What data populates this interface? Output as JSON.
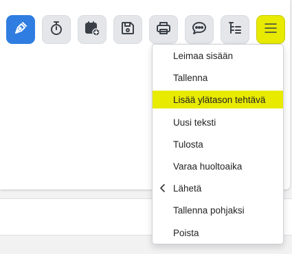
{
  "toolbar": {
    "buttons": [
      {
        "name": "sign-button",
        "icon": "pen-nib-icon"
      },
      {
        "name": "timer-button",
        "icon": "stopwatch-icon"
      },
      {
        "name": "schedule-button",
        "icon": "calendar-add-icon"
      },
      {
        "name": "save-button",
        "icon": "floppy-disk-icon"
      },
      {
        "name": "print-button",
        "icon": "printer-icon"
      },
      {
        "name": "comment-button",
        "icon": "chat-bubble-icon"
      },
      {
        "name": "hierarchy-button",
        "icon": "tree-list-icon"
      },
      {
        "name": "more-menu-button",
        "icon": "hamburger-menu-icon"
      }
    ],
    "colors": {
      "primary": "#2f7de1",
      "active": "#e8ea00",
      "button_bg": "#e4e6ea",
      "icon": "#3a3f47"
    }
  },
  "menu": {
    "items": [
      {
        "label": "Leimaa sisään"
      },
      {
        "label": "Tallenna"
      },
      {
        "label": "Lisää ylätason tehtävä",
        "highlighted": true
      },
      {
        "label": "Uusi teksti"
      },
      {
        "label": "Tulosta"
      },
      {
        "label": "Varaa huoltoaika"
      },
      {
        "label": "Lähetä",
        "has_submenu": true,
        "submenu_icon": "chevron-left-icon"
      },
      {
        "label": "Tallenna pohjaksi"
      },
      {
        "label": "Poista"
      }
    ]
  }
}
